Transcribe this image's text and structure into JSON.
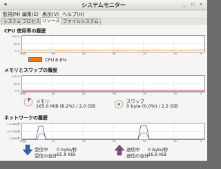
{
  "window": {
    "title": "システムモニター"
  },
  "menu": [
    "監視(M)",
    "編集(E)",
    "表示(V)",
    "ヘルプ(H)"
  ],
  "tabs": [
    "システム",
    "プロセス",
    "リソース",
    "ファイルシステム"
  ],
  "active_tab": "リソース",
  "axis": {
    "x_ticks": [
      "60秒",
      "50",
      "40",
      "30",
      "20",
      "10",
      "0"
    ],
    "percent_ticks": [
      "100 %",
      "50 %",
      "0 %"
    ],
    "net_ticks": [
      "1.4 KiB/秒",
      "0.7 KiB/秒",
      "0 KiB/秒"
    ]
  },
  "cpu": {
    "title": "CPU 使用率の履歴",
    "label": "CPU",
    "value": "8.8%",
    "color": "#f57900"
  },
  "memory": {
    "title": "メモリとスワップの履歴",
    "mem_label": "メモリ",
    "mem_value": "165.0 MiB (8.2%) / 2.0 GiB",
    "mem_color": "#ad1e4a",
    "swap_label": "スワップ",
    "swap_value": "0 byte (0.0%) / 2.2 GiB",
    "swap_color": "#4e9a06"
  },
  "network": {
    "title": "ネットワークの履歴",
    "recv_label": "受信中",
    "recv_rate": "0 byte/秒",
    "recv_total_label": "受信の合計",
    "recv_total": "65.9 KiB",
    "recv_color": "#3465a4",
    "send_label": "送信中",
    "send_rate": "0 byte/秒",
    "send_total_label": "送信の合計",
    "send_total": "16.6 KiB",
    "send_color": "#75507b"
  }
}
